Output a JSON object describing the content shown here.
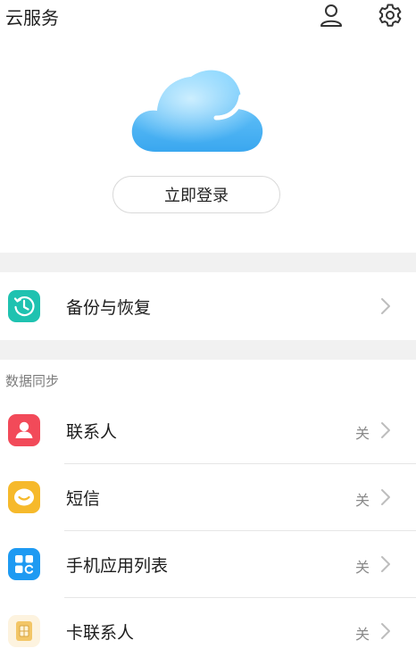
{
  "header": {
    "title": "云服务"
  },
  "login": {
    "label": "立即登录"
  },
  "backup": {
    "label": "备份与恢复"
  },
  "sync": {
    "section_label": "数据同步",
    "items": [
      {
        "label": "联系人",
        "state": "关"
      },
      {
        "label": "短信",
        "state": "关"
      },
      {
        "label": "手机应用列表",
        "state": "关"
      },
      {
        "label": "卡联系人",
        "state": "关"
      }
    ]
  },
  "colors": {
    "backup_icon": "#1fc2b0",
    "contacts_icon": "#f24a59",
    "sms_icon": "#f6b92b",
    "apps_icon": "#1e9af2",
    "card_icon": "#f3c667"
  }
}
